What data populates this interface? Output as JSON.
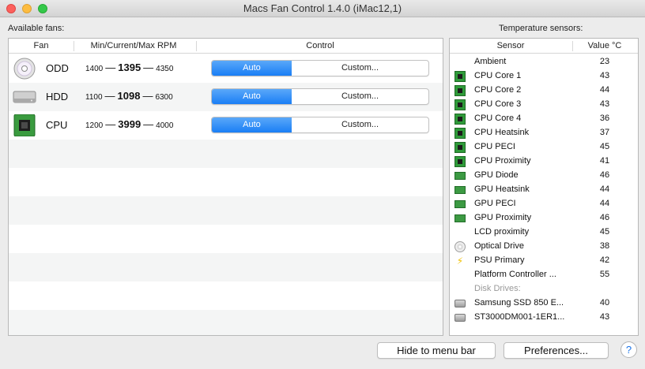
{
  "window": {
    "title": "Macs Fan Control 1.4.0 (iMac12,1)"
  },
  "fans_section": {
    "label": "Available fans:",
    "headers": {
      "fan": "Fan",
      "rpm": "Min/Current/Max RPM",
      "control": "Control"
    },
    "fans": [
      {
        "name": "ODD",
        "icon": "optical-drive-icon",
        "min": "1400",
        "current": "1395",
        "max": "4350",
        "auto_label": "Auto",
        "custom_label": "Custom..."
      },
      {
        "name": "HDD",
        "icon": "hard-drive-icon",
        "min": "1100",
        "current": "1098",
        "max": "6300",
        "auto_label": "Auto",
        "custom_label": "Custom..."
      },
      {
        "name": "CPU",
        "icon": "cpu-chip-icon",
        "min": "1200",
        "current": "3999",
        "max": "4000",
        "auto_label": "Auto",
        "custom_label": "Custom..."
      }
    ]
  },
  "temps_section": {
    "label": "Temperature sensors:",
    "headers": {
      "sensor": "Sensor",
      "value": "Value °C"
    },
    "sensors": [
      {
        "name": "Ambient",
        "value": "23",
        "icon": "none"
      },
      {
        "name": "CPU Core 1",
        "value": "43",
        "icon": "cpu-chip-icon"
      },
      {
        "name": "CPU Core 2",
        "value": "44",
        "icon": "cpu-chip-icon"
      },
      {
        "name": "CPU Core 3",
        "value": "43",
        "icon": "cpu-chip-icon"
      },
      {
        "name": "CPU Core 4",
        "value": "36",
        "icon": "cpu-chip-icon"
      },
      {
        "name": "CPU Heatsink",
        "value": "37",
        "icon": "cpu-chip-icon"
      },
      {
        "name": "CPU PECI",
        "value": "45",
        "icon": "cpu-chip-icon"
      },
      {
        "name": "CPU Proximity",
        "value": "41",
        "icon": "cpu-chip-icon"
      },
      {
        "name": "GPU Diode",
        "value": "46",
        "icon": "gpu-card-icon"
      },
      {
        "name": "GPU Heatsink",
        "value": "44",
        "icon": "gpu-card-icon"
      },
      {
        "name": "GPU PECI",
        "value": "44",
        "icon": "gpu-card-icon"
      },
      {
        "name": "GPU Proximity",
        "value": "46",
        "icon": "gpu-card-icon"
      },
      {
        "name": "LCD proximity",
        "value": "45",
        "icon": "none"
      },
      {
        "name": "Optical Drive",
        "value": "38",
        "icon": "optical-drive-icon"
      },
      {
        "name": "PSU Primary",
        "value": "42",
        "icon": "lightning-bolt-icon"
      },
      {
        "name": "Platform Controller ...",
        "value": "55",
        "icon": "none"
      }
    ],
    "disk_label": "Disk Drives:",
    "disks": [
      {
        "name": "Samsung SSD 850 E...",
        "value": "40",
        "icon": "ssd-drive-icon"
      },
      {
        "name": "ST3000DM001-1ER1...",
        "value": "43",
        "icon": "hard-drive-icon"
      }
    ]
  },
  "footer": {
    "hide_label": "Hide to menu bar",
    "prefs_label": "Preferences...",
    "help_label": "?"
  },
  "colors": {
    "accent": "#1a7ef5",
    "chip_green": "#2f9b3a"
  }
}
